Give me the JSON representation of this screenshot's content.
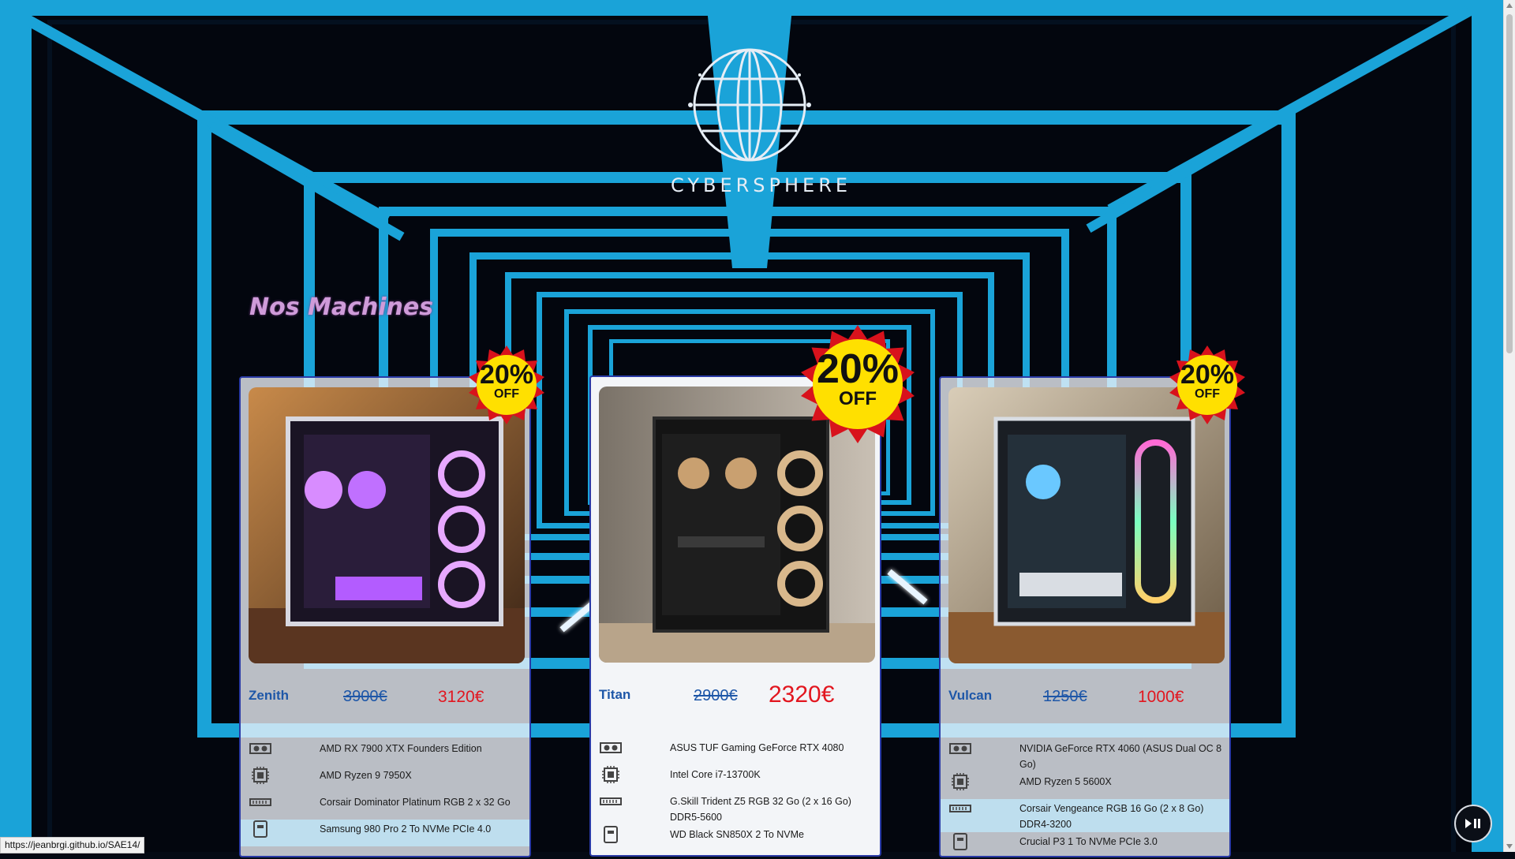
{
  "brand": {
    "name": "CYBERSPHERE"
  },
  "section": {
    "title": "Nos Machines"
  },
  "discount_badge": {
    "percent": "20%",
    "label": "OFF"
  },
  "products": [
    {
      "name": "Zenith",
      "old_price": "3900€",
      "new_price": "3120€",
      "specs": [
        {
          "icon": "gpu-icon",
          "text": "AMD RX 7900 XTX Founders Edition"
        },
        {
          "icon": "cpu-icon",
          "text": "AMD Ryzen 9 7950X"
        },
        {
          "icon": "ram-icon",
          "text": "Corsair Dominator Platinum RGB 2 x 32 Go"
        },
        {
          "icon": "ssd-icon",
          "text": "Samsung 980 Pro 2 To NVMe PCIe 4.0"
        }
      ]
    },
    {
      "name": "Titan",
      "old_price": "2900€",
      "new_price": "2320€",
      "specs": [
        {
          "icon": "gpu-icon",
          "text": "ASUS TUF Gaming GeForce RTX 4080"
        },
        {
          "icon": "cpu-icon",
          "text": "Intel Core i7-13700K"
        },
        {
          "icon": "ram-icon",
          "text": "G.Skill Trident Z5 RGB 32 Go (2 x 16 Go) DDR5-5600"
        },
        {
          "icon": "ssd-icon",
          "text": "WD Black SN850X 2 To NVMe"
        }
      ]
    },
    {
      "name": "Vulcan",
      "old_price": "1250€",
      "new_price": "1000€",
      "specs": [
        {
          "icon": "gpu-icon",
          "text": "NVIDIA GeForce RTX 4060 (ASUS Dual OC 8 Go)"
        },
        {
          "icon": "cpu-icon",
          "text": "AMD Ryzen 5 5600X"
        },
        {
          "icon": "ram-icon",
          "text": "Corsair Vengeance RGB 16 Go (2 x 8 Go) DDR4-3200"
        },
        {
          "icon": "ssd-icon",
          "text": "Crucial P3 1 To NVMe PCIe 3.0"
        }
      ]
    }
  ],
  "status_bar": {
    "url": "https://jeanbrgi.github.io/SAE14/"
  },
  "colors": {
    "accent": "#1aa3d8",
    "price_new": "#e2161f",
    "price_old": "#1e57a8",
    "title": "#cf9bd9"
  }
}
